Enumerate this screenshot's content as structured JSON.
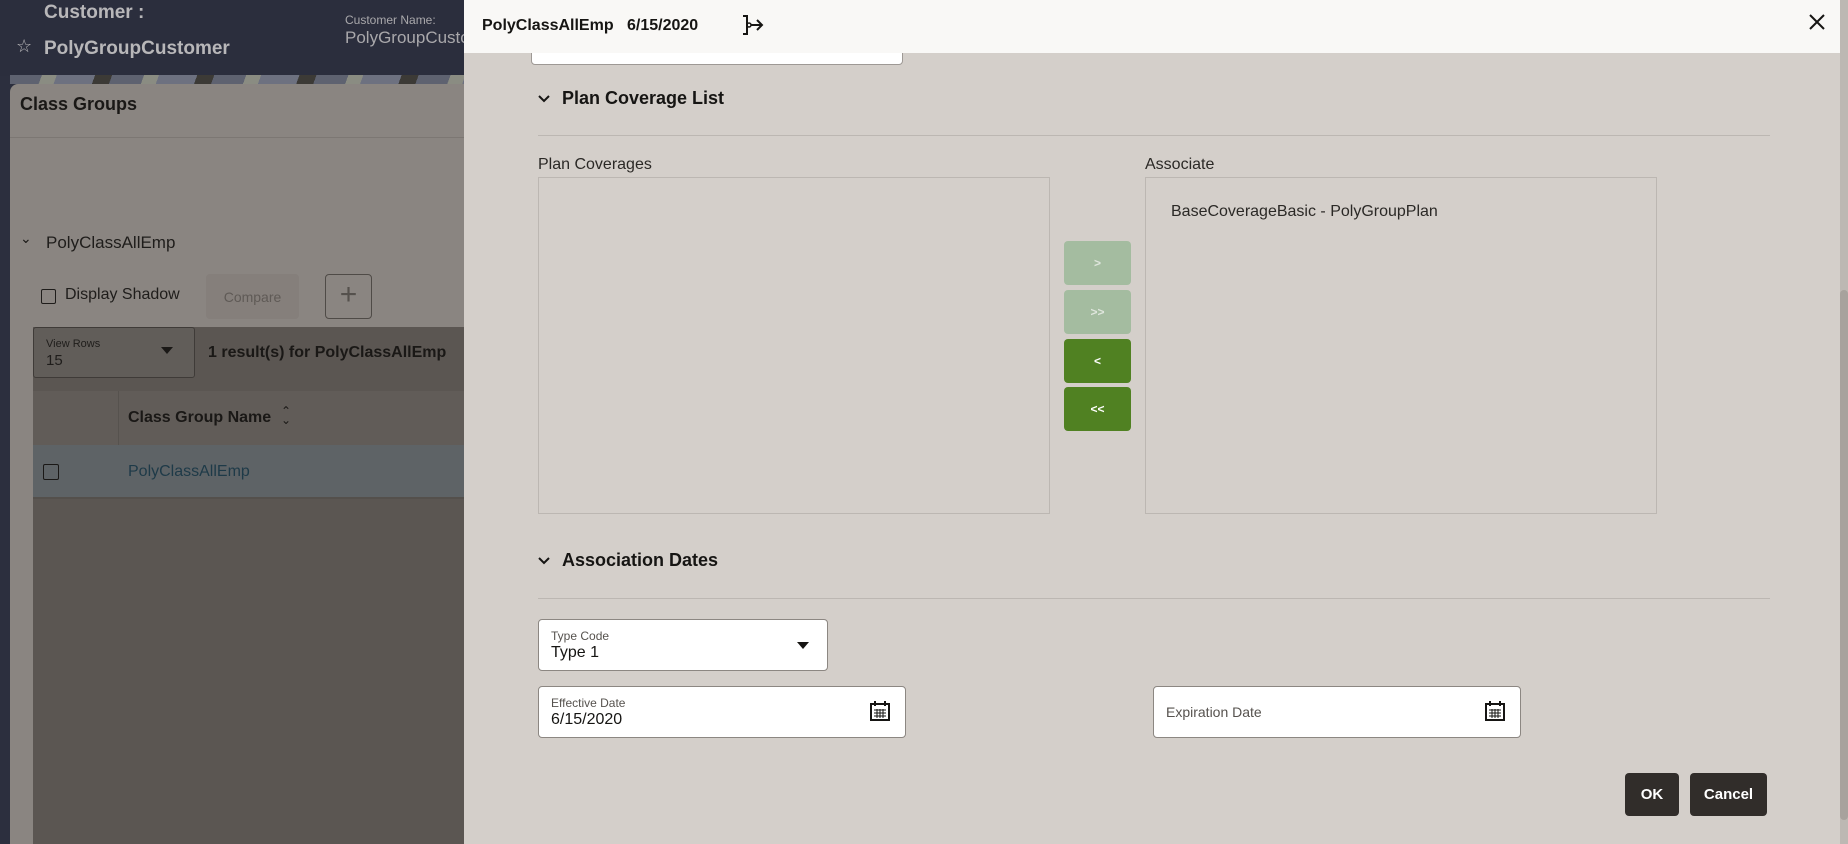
{
  "background_app": {
    "customer_label": "Customer :",
    "customer_name": "PolyGroupCustomer",
    "customer_name_field_label": "Customer Name:",
    "customer_name_field_value": "PolyGroupCusto",
    "panel_title": "Class Groups",
    "group_name": "PolyClassAllEmp",
    "display_shadow_label": "Display Shadow",
    "compare_label": "Compare",
    "add_label": "+",
    "view_rows_label": "View Rows",
    "view_rows_value": "15",
    "result_count": "1 result(s) for PolyClassAllEmp",
    "table": {
      "columns": [
        "Class Group Name"
      ],
      "rows": [
        {
          "class_group_name": "PolyClassAllEmp"
        }
      ]
    }
  },
  "dialog": {
    "title": "PolyClassAllEmp",
    "date": "6/15/2020",
    "plan_coverage_section": {
      "heading": "Plan Coverage List",
      "available_label": "Plan Coverages",
      "available_items": [],
      "associated_label": "Associate",
      "associated_items": [
        "BaseCoverageBasic - PolyGroupPlan"
      ],
      "buttons": {
        "move_right": ">",
        "move_all_right": ">>",
        "move_left": "<",
        "move_all_left": "<<"
      }
    },
    "association_dates_section": {
      "heading": "Association Dates",
      "type_code_label": "Type Code",
      "type_code_value": "Type 1",
      "effective_date_label": "Effective Date",
      "effective_date_value": "6/15/2020",
      "expiration_date_placeholder": "Expiration Date"
    },
    "ok_label": "OK",
    "cancel_label": "Cancel"
  },
  "colors": {
    "accent_green": "#508122",
    "disabled_green": "#a4bca0",
    "dark_button": "#312d2a",
    "dialog_bg": "#d4cfca",
    "header_bg": "#2b2e3d"
  }
}
